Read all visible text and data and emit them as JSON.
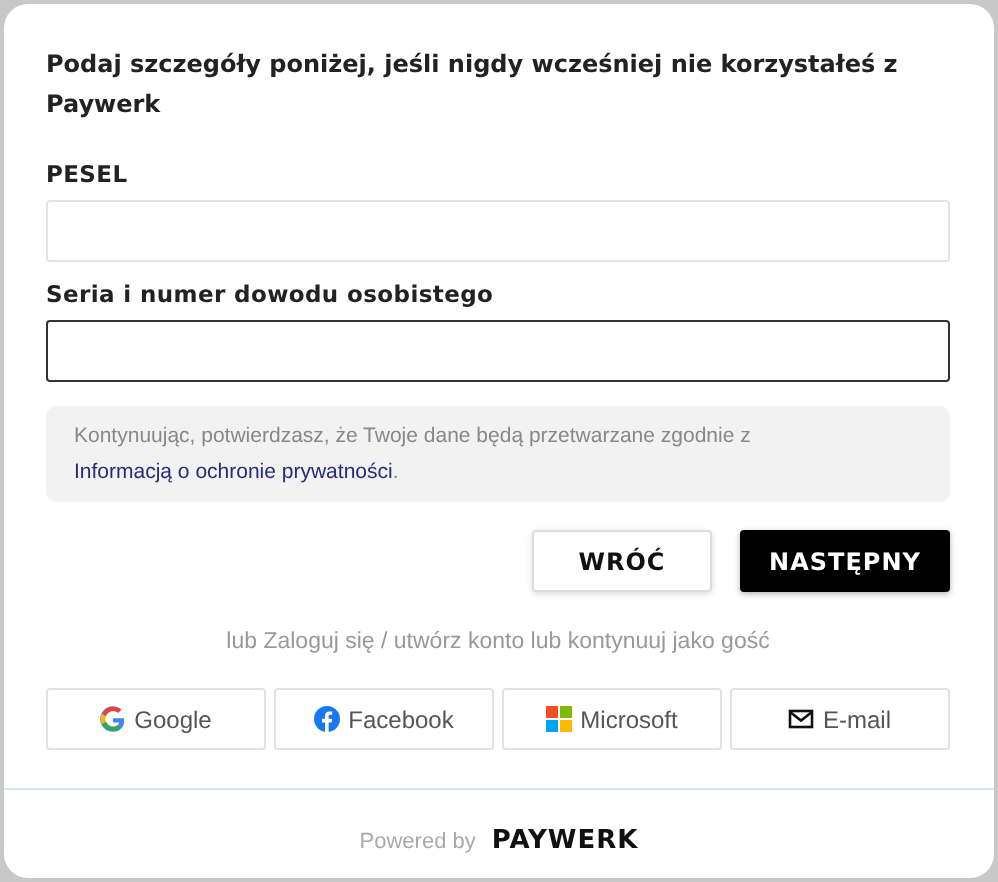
{
  "title": "Podaj szczegóły poniżej, jeśli nigdy wcześniej nie korzystałeś z Paywerk",
  "fields": [
    {
      "label": "PESEL",
      "focused": false
    },
    {
      "label": "Seria i numer dowodu osobistego",
      "focused": true
    }
  ],
  "notice": {
    "text": "Kontynuując, potwierdzasz, że Twoje dane będą przetwarzane zgodnie z ",
    "link": "Informacją o ochronie prywatności",
    "end": "."
  },
  "buttons": [
    {
      "label": "WRÓĆ",
      "kind": "secondary"
    },
    {
      "label": "NASTĘPNY",
      "kind": "primary"
    }
  ],
  "alt_text": "lub Zaloguj się / utwórz konto lub kontynuuj jako gość",
  "social": [
    {
      "label": "Google",
      "kind": "google"
    },
    {
      "label": "Facebook",
      "kind": "facebook"
    },
    {
      "label": "Microsoft",
      "kind": "microsoft"
    },
    {
      "label": "E-mail",
      "kind": "email"
    }
  ],
  "footer": {
    "powered": "Powered by",
    "logo": "PAYWERK"
  }
}
